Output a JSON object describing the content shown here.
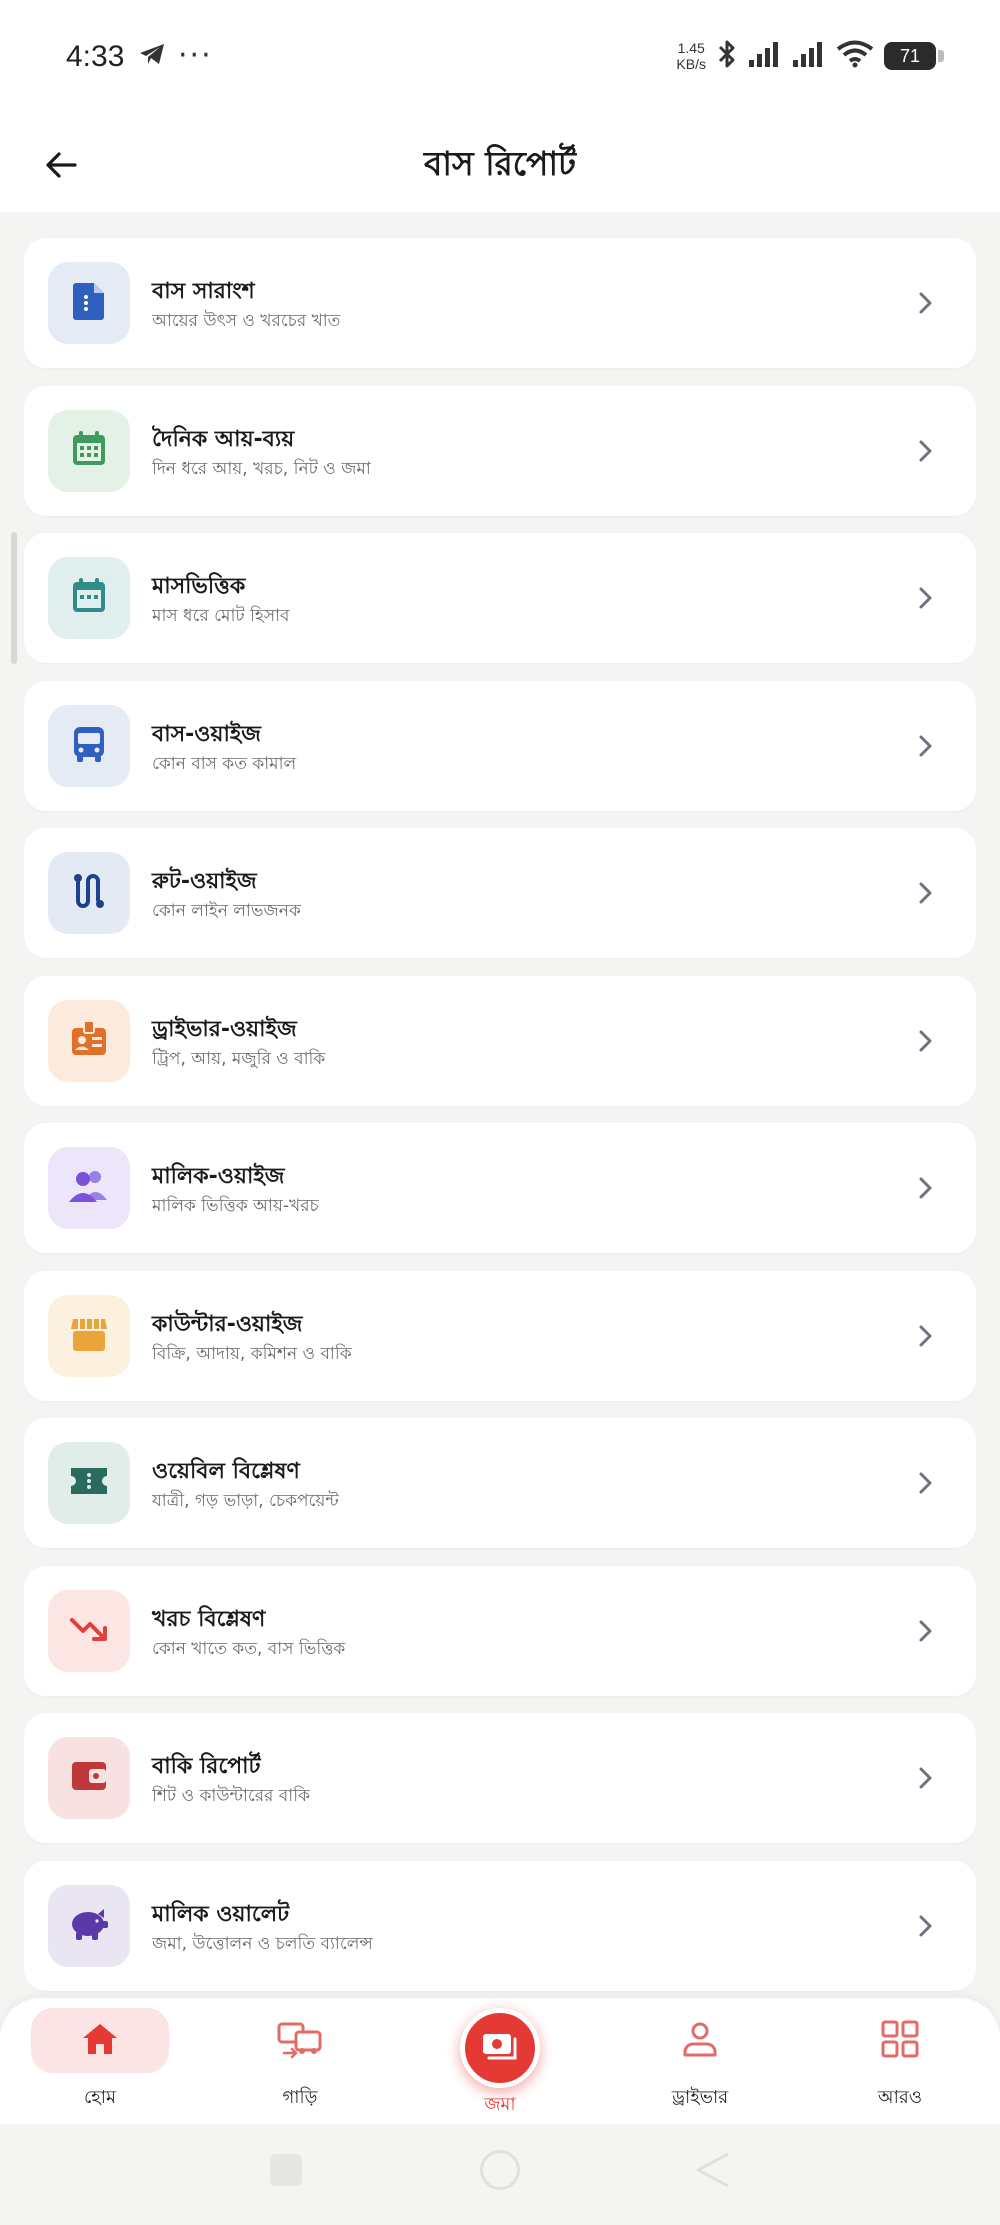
{
  "status_bar": {
    "time": "4:33",
    "net_speed_value": "1.45",
    "net_speed_unit": "KB/s",
    "battery": "71"
  },
  "header": {
    "title": "বাস রিপোর্ট"
  },
  "reports": [
    {
      "title": "বাস সারাংশ",
      "subtitle": "আয়ের উৎস ও খরচের খাত",
      "icon": "document-icon",
      "icon_color": "#2f5fbf",
      "icon_bg": "#e4ebf5"
    },
    {
      "title": "দৈনিক আয়-ব্যয়",
      "subtitle": "দিন ধরে আয়, খরচ, নিট ও জমা",
      "icon": "calendar-icon",
      "icon_color": "#3f9a5e",
      "icon_bg": "#e3f1e6"
    },
    {
      "title": "মাসভিত্তিক",
      "subtitle": "মাস ধরে মোট হিসাব",
      "icon": "calendar-month-icon",
      "icon_color": "#2f8c86",
      "icon_bg": "#e0efed"
    },
    {
      "title": "বাস-ওয়াইজ",
      "subtitle": "কোন বাস কত কামাল",
      "icon": "bus-icon",
      "icon_color": "#2f5fbf",
      "icon_bg": "#e4ebf5"
    },
    {
      "title": "রুট-ওয়াইজ",
      "subtitle": "কোন লাইন লাভজনক",
      "icon": "route-icon",
      "icon_color": "#1f3f8f",
      "icon_bg": "#e4eaf3"
    },
    {
      "title": "ড্রাইভার-ওয়াইজ",
      "subtitle": "ট্রিপ, আয়, মজুরি ও বাকি",
      "icon": "id-badge-icon",
      "icon_color": "#e0702a",
      "icon_bg": "#fcebdd"
    },
    {
      "title": "মালিক-ওয়াইজ",
      "subtitle": "মালিক ভিত্তিক আয়-খরচ",
      "icon": "users-icon",
      "icon_color": "#7b52d9",
      "icon_bg": "#ede6fb"
    },
    {
      "title": "কাউন্টার-ওয়াইজ",
      "subtitle": "বিক্রি, আদায়, কমিশন ও বাকি",
      "icon": "store-icon",
      "icon_color": "#e9a53a",
      "icon_bg": "#fcf0de"
    },
    {
      "title": "ওয়েবিল বিশ্লেষণ",
      "subtitle": "যাত্রী, গড় ভাড়া, চেকপয়েন্ট",
      "icon": "ticket-icon",
      "icon_color": "#2b6b5d",
      "icon_bg": "#e1ede9"
    },
    {
      "title": "খরচ বিশ্লেষণ",
      "subtitle": "কোন খাতে কত, বাস ভিত্তিক",
      "icon": "trend-down-icon",
      "icon_color": "#e0403b",
      "icon_bg": "#fbe6e4"
    },
    {
      "title": "বাকি রিপোর্ট",
      "subtitle": "শিট ও কাউন্টারের বাকি",
      "icon": "wallet-icon",
      "icon_color": "#c0393a",
      "icon_bg": "#f7e2e1"
    },
    {
      "title": "মালিক ওয়ালেট",
      "subtitle": "জমা, উত্তোলন ও চলতি ব্যালেন্স",
      "icon": "piggy-bank-icon",
      "icon_color": "#5b3aa8",
      "icon_bg": "#e9e5f3"
    }
  ],
  "bottom_nav": {
    "home": "হোম",
    "cars": "গাড়ি",
    "deposit": "জমা",
    "driver": "ড্রাইভার",
    "more": "আরও"
  },
  "colors": {
    "accent": "#e53935",
    "chevron": "#6b7280"
  }
}
